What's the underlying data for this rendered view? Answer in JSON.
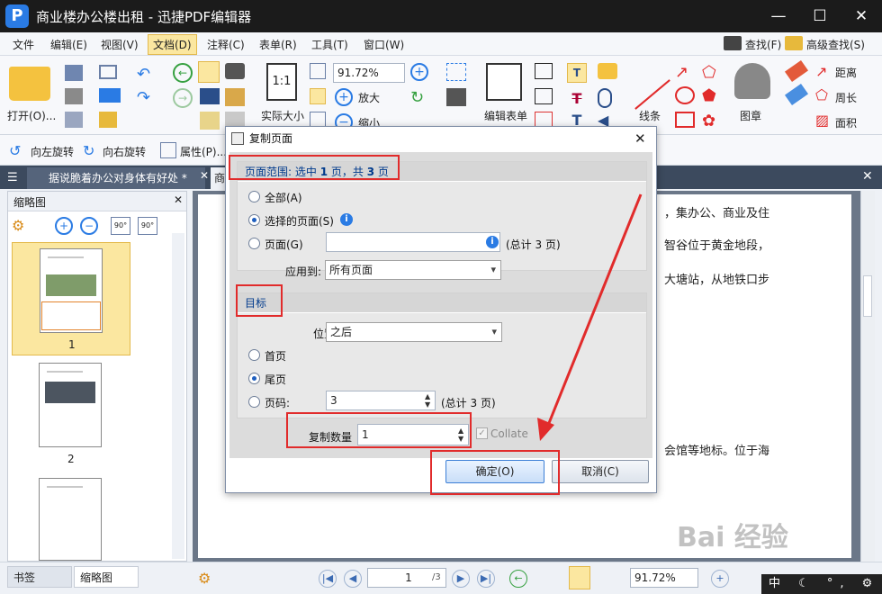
{
  "window": {
    "title": "商业楼办公楼出租 - 迅捷PDF编辑器",
    "logo": "P"
  },
  "menu": [
    "文件",
    "编辑(E)",
    "视图(V)",
    "文档(D)",
    "注释(C)",
    "表单(R)",
    "工具(T)",
    "窗口(W)"
  ],
  "menu_right": {
    "find": "查找(F)",
    "advanced_find": "高级查找(S)"
  },
  "ribbon": {
    "open": "打开(O)...",
    "zoom_value": "91.72%",
    "actual_size": "实际大小",
    "zoom_in": "放大",
    "zoom_out": "缩小",
    "edit_form": "编辑表单",
    "line": "线条",
    "stamp": "图章",
    "distance": "距离",
    "perimeter": "周长",
    "area": "面积",
    "fit_box": "1:1"
  },
  "toolbar2": {
    "rotate_left": "向左旋转",
    "rotate_right": "向右旋转",
    "properties": "属性(P)..."
  },
  "tabs": {
    "doc_tab": "据说脆着办公对身体有好处 *",
    "second_tab": "商"
  },
  "sidebar": {
    "title": "缩略图",
    "thumbs": [
      "1",
      "2"
    ],
    "rot_left": "90°",
    "rot_right": "90°"
  },
  "doc_text": [
    "，集办公、商业及住",
    "智谷位于黄金地段，",
    "大塘站，从地铁口步",
    "会馆等地标。位于海"
  ],
  "status": {
    "bookmarks_tab": "书签",
    "thumbs_tab": "缩略图",
    "page_input": "1",
    "page_total": "/3",
    "zoom": "91.72%"
  },
  "ime": "中 ☾ °, ⚙",
  "watermark": "Bai 经验",
  "dialog": {
    "title": "复制页面",
    "range_header_prefix": "页面范围: 选中 ",
    "range_sel": "1",
    "range_mid": " 页，共 ",
    "range_total": "3",
    "range_suffix": " 页",
    "opt_all": "全部(A)",
    "opt_selected": "选择的页面(S)",
    "opt_pages": "页面(G)",
    "pages_total": "(总计 3 页)",
    "apply_to_label": "应用到:",
    "apply_to_value": "所有页面",
    "target_header": "目标",
    "position_label": "位置:",
    "position_value": "之后",
    "opt_first": "首页",
    "opt_last": "尾页",
    "opt_pagenum": "页码:",
    "pagenum_value": "3",
    "pagenum_total": "(总计 3 页)",
    "copies_label": "复制数量",
    "copies_value": "1",
    "collate": "Collate",
    "ok": "确定(O)",
    "cancel": "取消(C)"
  },
  "colors": {
    "accent": "#2a7be4",
    "highlight_red": "#e12b2b",
    "title_bar": "#1b1b1b"
  }
}
